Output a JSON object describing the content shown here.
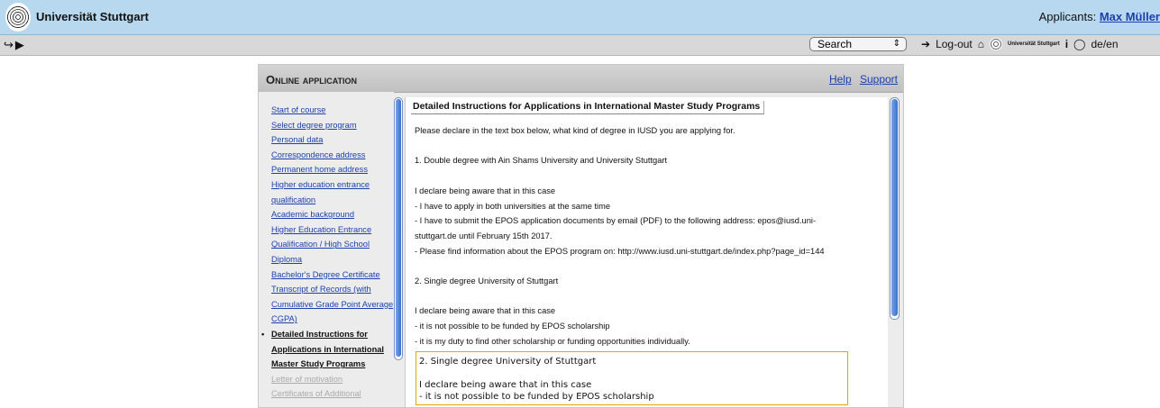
{
  "header": {
    "university_name": "Universität Stuttgart",
    "applicants_label": "Applicants:",
    "user_name": "Max Müller"
  },
  "toolbar": {
    "search_selected": "Search",
    "logout_label": "Log-out",
    "small_logo_text": "Universität Stuttgart",
    "language_label": "de/en"
  },
  "panel": {
    "title": "Online application",
    "help_link": "Help",
    "support_link": "Support"
  },
  "sidebar": {
    "items": [
      {
        "label": "Start of course",
        "state": "link"
      },
      {
        "label": "Select degree program",
        "state": "link"
      },
      {
        "label": "Personal data",
        "state": "link"
      },
      {
        "label": "Correspondence address",
        "state": "link"
      },
      {
        "label": "Permanent home address",
        "state": "link"
      },
      {
        "label": "Higher education entrance",
        "state": "link"
      },
      {
        "label": "qualification",
        "state": "link"
      },
      {
        "label": "Academic background",
        "state": "link"
      },
      {
        "label": "Higher Education Entrance",
        "state": "link"
      },
      {
        "label": "Qualification / High School",
        "state": "link"
      },
      {
        "label": "Diploma",
        "state": "link"
      },
      {
        "label": "Bachelor's Degree Certificate",
        "state": "link"
      },
      {
        "label": "Transcript of Records (with",
        "state": "link"
      },
      {
        "label": "Cumulative Grade Point Average",
        "state": "link"
      },
      {
        "label": "CGPA)",
        "state": "link"
      },
      {
        "label": "Detailed Instructions for",
        "state": "active"
      },
      {
        "label": "Applications in International",
        "state": "active"
      },
      {
        "label": "Master Study Programs",
        "state": "active"
      },
      {
        "label": "Letter of motivation",
        "state": "disabled"
      },
      {
        "label": "Certificates of Additional",
        "state": "disabled"
      }
    ]
  },
  "content": {
    "tab_title": "Detailed Instructions for Applications in International Master Study Programs",
    "lines": [
      "Please declare in the text box below, what kind of degree in IUSD you are applying for.",
      "",
      "1. Double degree with Ain Shams University and University Stuttgart",
      "",
      "I declare being aware that in this case",
      "- I have to apply in both universities at the same time",
      "- I have to submit the EPOS application documents by email (PDF) to the following address: epos@iusd.uni-",
      "stuttgart.de until February 15th 2017.",
      "- Please find information about the EPOS program on: http://www.iusd.uni-stuttgart.de/index.php?page_id=144",
      "",
      "2. Single degree University of Stuttgart",
      "",
      "I declare being aware that in this case",
      "- it is not possible to be funded by EPOS scholarship",
      "- it is my duty to find other scholarship or funding opportunities individually."
    ],
    "textarea_value": "2. Single degree University of Stuttgart\n\nI declare being aware that in this case\n- it is not possible to be funded by EPOS scholarship"
  }
}
